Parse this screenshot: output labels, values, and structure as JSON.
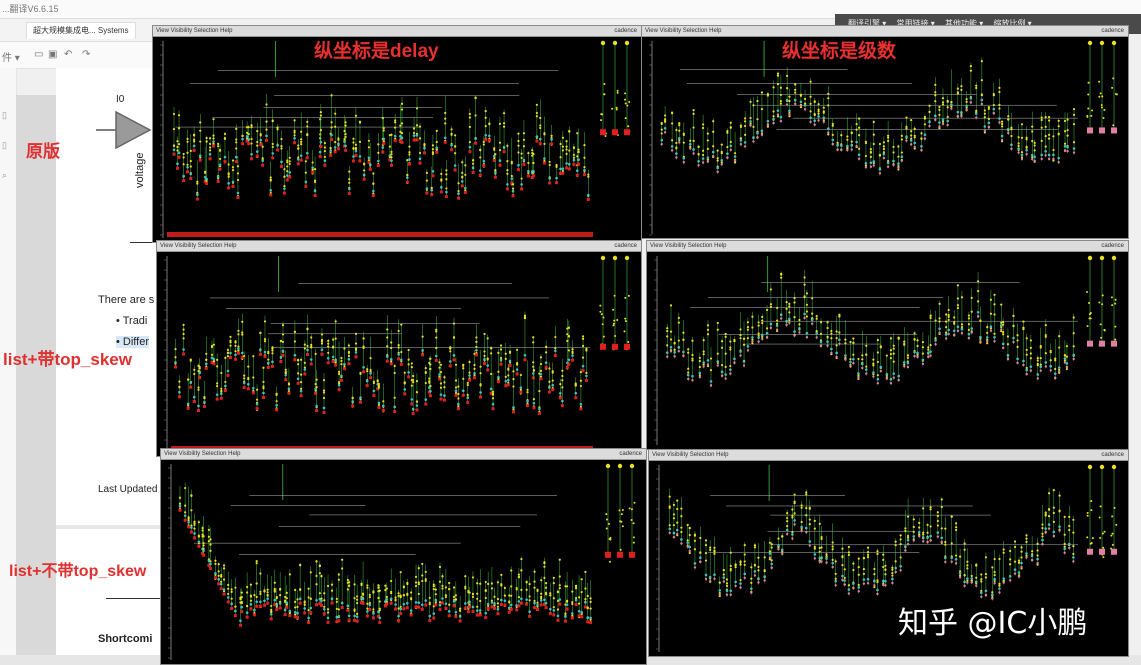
{
  "app": {
    "window_title": "...翻译V6.6.15",
    "tab_label": "超大规模集成电... Systems",
    "toolbar_first": "件 ▾"
  },
  "document": {
    "io_label": "I0",
    "voltage_label": "voltage",
    "para_start": "There are s",
    "bullet1": "Tradi",
    "bullet2": "Differ",
    "last_updated": "Last Updated",
    "shortcomings": "Shortcomi"
  },
  "labels": {
    "original": "原版",
    "list_with_skew": "list+带top_skew",
    "list_without_skew": "list+不带top_skew",
    "ylabel_delay": "纵坐标是delay",
    "ylabel_levels": "纵坐标是级数"
  },
  "right_menu": [
    "翻译引擎 ▾",
    "常用链接 ▾",
    "其他功能 ▾",
    "缩放比例 ▾"
  ],
  "window_menus": {
    "menu_text": "View  Visibility  Selection  Help",
    "window_title": "cadence"
  },
  "watermark": "知乎 @IC小鹏",
  "colors": {
    "label_red": "#e03030",
    "tree_yellow": "#e8e020",
    "tree_green": "#40c040",
    "tree_cyan": "#40c0c0",
    "tree_red": "#e02020"
  }
}
